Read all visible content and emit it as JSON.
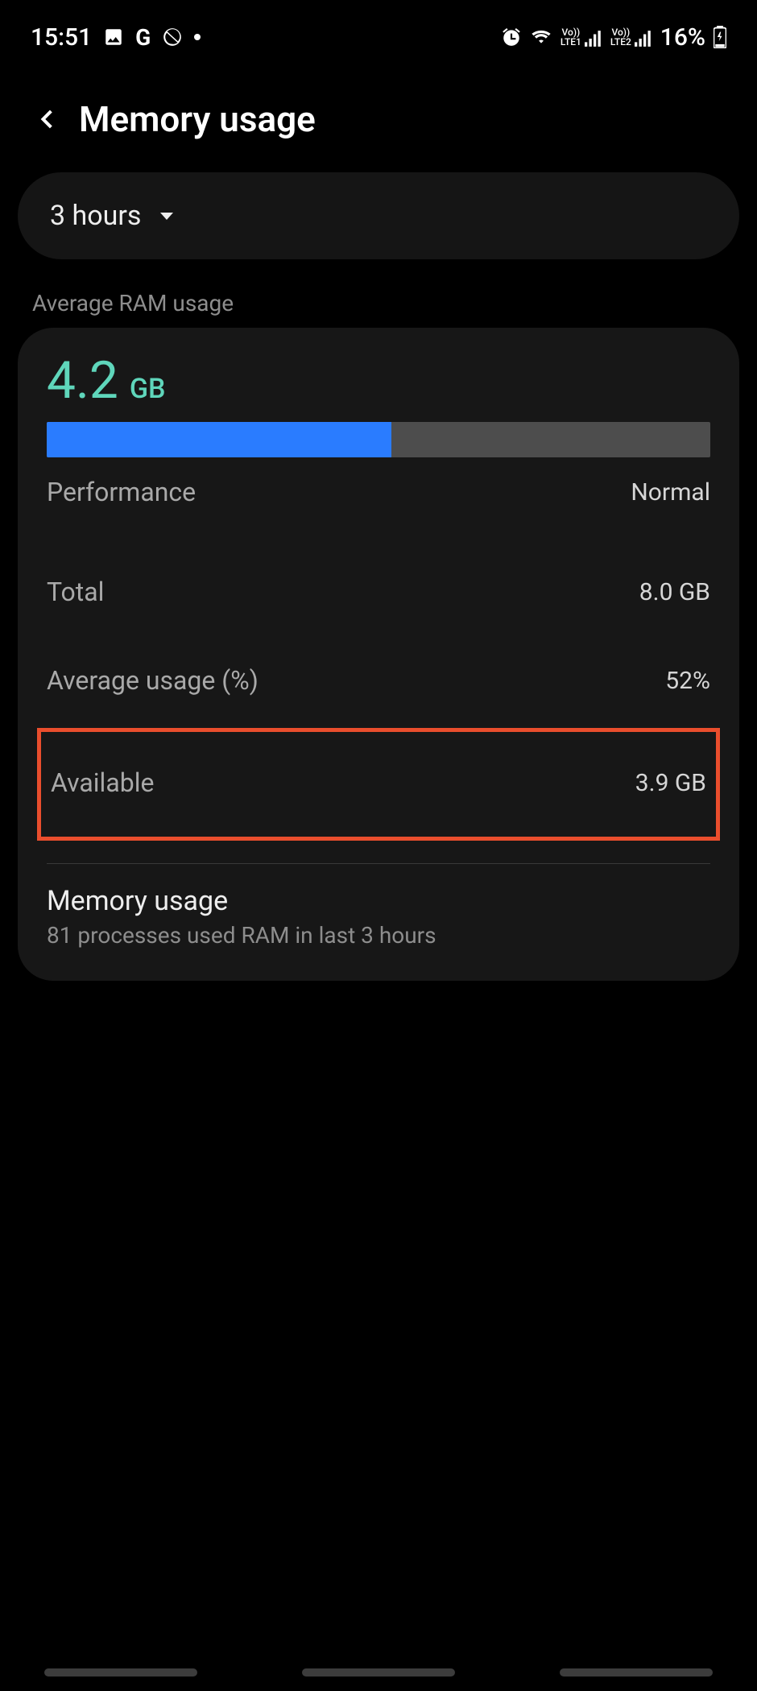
{
  "status": {
    "time": "15:51",
    "battery_text": "16%",
    "lte1": "LTE1",
    "lte2": "LTE2"
  },
  "appbar": {
    "title": "Memory usage"
  },
  "filter": {
    "selected": "3 hours"
  },
  "section": {
    "avg_label": "Average RAM usage"
  },
  "ram": {
    "value": "4.2",
    "unit": "GB",
    "bar_percent": 52,
    "rows": {
      "performance_label": "Performance",
      "performance_value": "Normal",
      "total_label": "Total",
      "total_value": "8.0 GB",
      "avg_pct_label": "Average usage (%)",
      "avg_pct_value": "52%",
      "available_label": "Available",
      "available_value": "3.9 GB"
    },
    "memory_link": {
      "title": "Memory usage",
      "subtitle": "81 processes used RAM in last 3 hours"
    }
  }
}
